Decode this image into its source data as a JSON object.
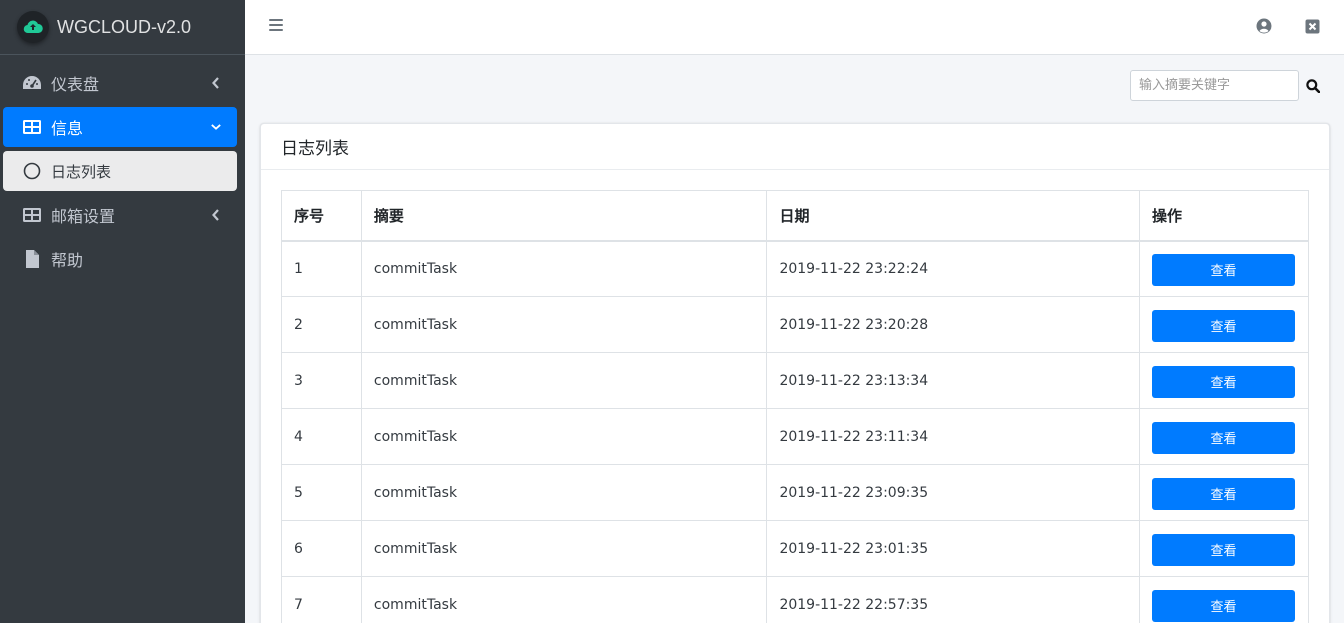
{
  "brand": {
    "title": "WGCLOUD-v2.0"
  },
  "sidebar": {
    "items": [
      {
        "label": "仪表盘",
        "icon": "dashboard-icon"
      },
      {
        "label": "信息",
        "icon": "table-icon"
      },
      {
        "label": "日志列表",
        "icon": "circle-icon"
      },
      {
        "label": "邮箱设置",
        "icon": "table-icon"
      },
      {
        "label": "帮助",
        "icon": "file-icon"
      }
    ]
  },
  "search": {
    "placeholder": "输入摘要关键字",
    "value": ""
  },
  "card": {
    "title": "日志列表"
  },
  "table": {
    "headers": [
      "序号",
      "摘要",
      "日期",
      "操作"
    ],
    "rows": [
      {
        "id": "1",
        "summary": "commitTask",
        "date": "2019-11-22 23:22:24",
        "action": "查看"
      },
      {
        "id": "2",
        "summary": "commitTask",
        "date": "2019-11-22 23:20:28",
        "action": "查看"
      },
      {
        "id": "3",
        "summary": "commitTask",
        "date": "2019-11-22 23:13:34",
        "action": "查看"
      },
      {
        "id": "4",
        "summary": "commitTask",
        "date": "2019-11-22 23:11:34",
        "action": "查看"
      },
      {
        "id": "5",
        "summary": "commitTask",
        "date": "2019-11-22 23:09:35",
        "action": "查看"
      },
      {
        "id": "6",
        "summary": "commitTask",
        "date": "2019-11-22 23:01:35",
        "action": "查看"
      },
      {
        "id": "7",
        "summary": "commitTask",
        "date": "2019-11-22 22:57:35",
        "action": "查看"
      }
    ]
  },
  "colors": {
    "sidebar": "#343a40",
    "accent": "#007bff",
    "brand_logo": "#20c997"
  }
}
